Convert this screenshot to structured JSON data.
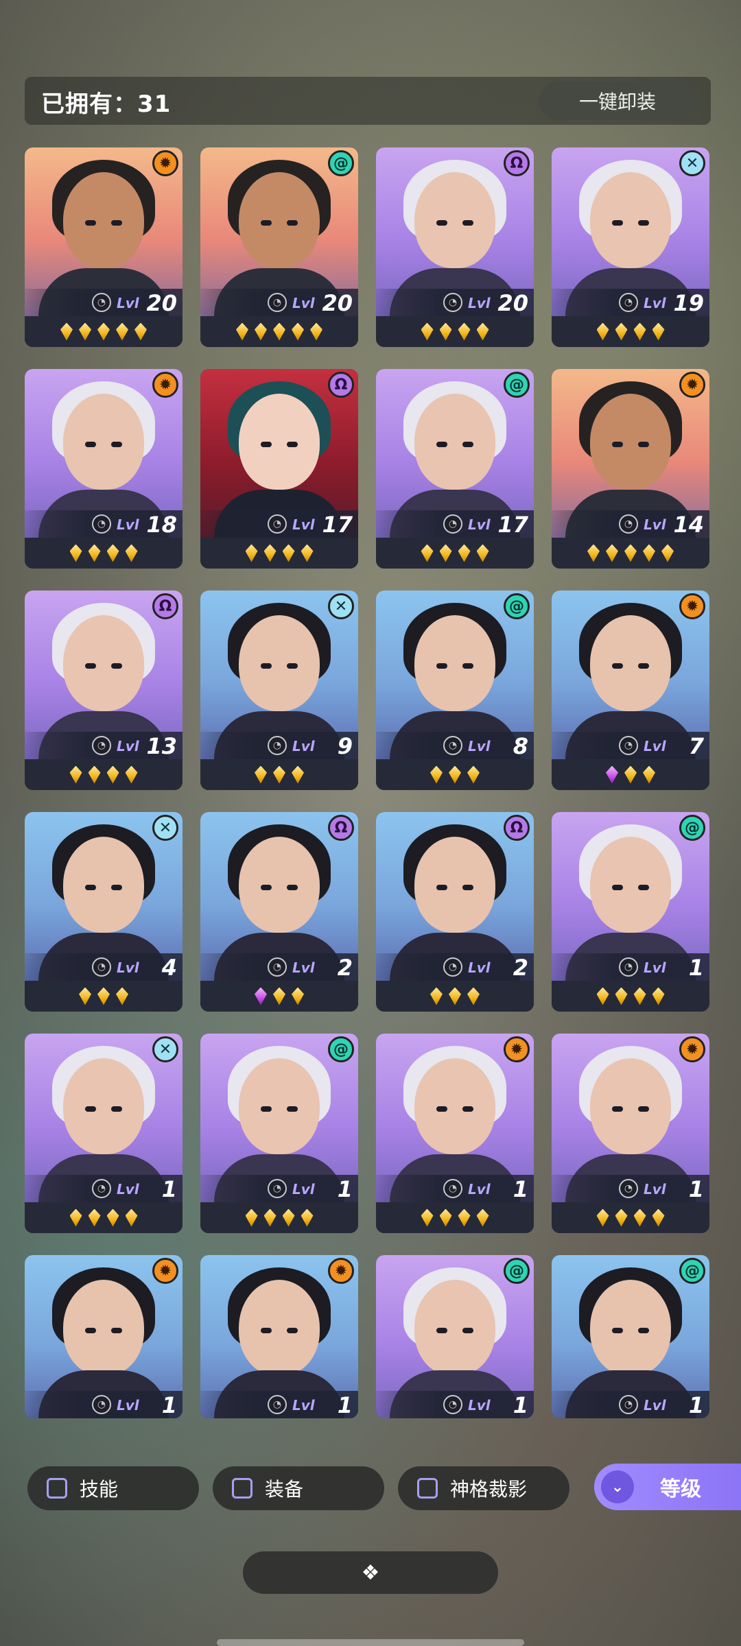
{
  "header": {
    "owned_label": "已拥有：31",
    "unequip_all_label": "一键卸装"
  },
  "colors": {
    "level_label": "#b8a6ff",
    "sort_button": "#8c74f6",
    "card_bg": "#262a38"
  },
  "heroes": [
    {
      "level_label": "Lvl",
      "level": "20",
      "gems_gold": 5,
      "gems_purple": 0,
      "element": "sun-icon",
      "theme": "orange"
    },
    {
      "level_label": "Lvl",
      "level": "20",
      "gems_gold": 5,
      "gems_purple": 0,
      "element": "spiral-icon",
      "theme": "orange"
    },
    {
      "level_label": "Lvl",
      "level": "20",
      "gems_gold": 4,
      "gems_purple": 0,
      "element": "omega-icon",
      "theme": "purple"
    },
    {
      "level_label": "Lvl",
      "level": "19",
      "gems_gold": 4,
      "gems_purple": 0,
      "element": "cross-icon",
      "theme": "purple"
    },
    {
      "level_label": "Lvl",
      "level": "18",
      "gems_gold": 4,
      "gems_purple": 0,
      "element": "sun-icon",
      "theme": "purple"
    },
    {
      "level_label": "Lvl",
      "level": "17",
      "gems_gold": 4,
      "gems_purple": 0,
      "element": "omega-icon",
      "theme": "red"
    },
    {
      "level_label": "Lvl",
      "level": "17",
      "gems_gold": 4,
      "gems_purple": 0,
      "element": "spiral-icon",
      "theme": "purple"
    },
    {
      "level_label": "Lvl",
      "level": "14",
      "gems_gold": 5,
      "gems_purple": 0,
      "element": "sun-icon",
      "theme": "orange"
    },
    {
      "level_label": "Lvl",
      "level": "13",
      "gems_gold": 4,
      "gems_purple": 0,
      "element": "omega-icon",
      "theme": "purple"
    },
    {
      "level_label": "Lvl",
      "level": "9",
      "gems_gold": 3,
      "gems_purple": 0,
      "element": "cross-icon",
      "theme": "blue"
    },
    {
      "level_label": "Lvl",
      "level": "8",
      "gems_gold": 3,
      "gems_purple": 0,
      "element": "spiral-icon",
      "theme": "blue"
    },
    {
      "level_label": "Lvl",
      "level": "7",
      "gems_gold": 2,
      "gems_purple": 1,
      "element": "sun-icon",
      "theme": "blue"
    },
    {
      "level_label": "Lvl",
      "level": "4",
      "gems_gold": 3,
      "gems_purple": 0,
      "element": "cross-icon",
      "theme": "blue"
    },
    {
      "level_label": "Lvl",
      "level": "2",
      "gems_gold": 2,
      "gems_purple": 1,
      "element": "omega-icon",
      "theme": "blue"
    },
    {
      "level_label": "Lvl",
      "level": "2",
      "gems_gold": 3,
      "gems_purple": 0,
      "element": "omega-icon",
      "theme": "blue"
    },
    {
      "level_label": "Lvl",
      "level": "1",
      "gems_gold": 4,
      "gems_purple": 0,
      "element": "spiral-icon",
      "theme": "purple"
    },
    {
      "level_label": "Lvl",
      "level": "1",
      "gems_gold": 4,
      "gems_purple": 0,
      "element": "cross-icon",
      "theme": "purple"
    },
    {
      "level_label": "Lvl",
      "level": "1",
      "gems_gold": 4,
      "gems_purple": 0,
      "element": "spiral-icon",
      "theme": "purple"
    },
    {
      "level_label": "Lvl",
      "level": "1",
      "gems_gold": 4,
      "gems_purple": 0,
      "element": "sun-icon",
      "theme": "purple"
    },
    {
      "level_label": "Lvl",
      "level": "1",
      "gems_gold": 4,
      "gems_purple": 0,
      "element": "sun-icon",
      "theme": "purple"
    },
    {
      "level_label": "Lvl",
      "level": "1",
      "gems_gold": 0,
      "gems_purple": 0,
      "element": "sun-icon",
      "theme": "blue"
    },
    {
      "level_label": "Lvl",
      "level": "1",
      "gems_gold": 0,
      "gems_purple": 0,
      "element": "sun-icon",
      "theme": "blue"
    },
    {
      "level_label": "Lvl",
      "level": "1",
      "gems_gold": 0,
      "gems_purple": 0,
      "element": "spiral-icon",
      "theme": "purple"
    },
    {
      "level_label": "Lvl",
      "level": "1",
      "gems_gold": 0,
      "gems_purple": 0,
      "element": "spiral-icon",
      "theme": "blue"
    }
  ],
  "filters": {
    "skills": "技能",
    "equipment": "装备",
    "divinity_shadow": "神格裁影",
    "sort_level": "等级"
  },
  "collapse_icon": "diamond-chevron-icon"
}
